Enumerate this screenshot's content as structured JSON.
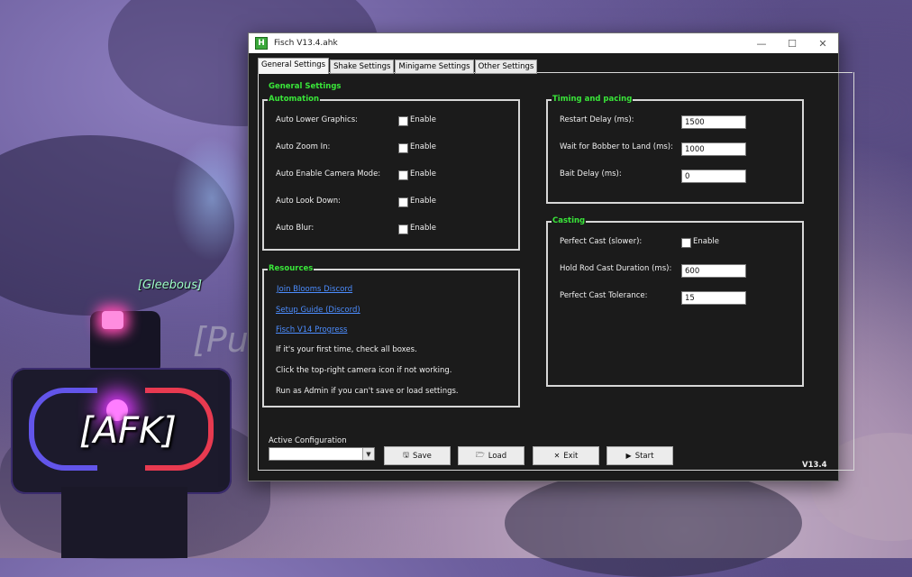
{
  "background": {
    "npc_name_1": "[Gleebous]",
    "npc_name_2": "[Pu",
    "player_tag": "[AFK]"
  },
  "window": {
    "title": "Fisch V13.4.ahk",
    "app_icon_letter": "H",
    "controls": {
      "minimize": "—",
      "maximize": "☐",
      "close": "✕"
    }
  },
  "tabs": [
    "General Settings",
    "Shake Settings",
    "Minigame Settings",
    "Other Settings"
  ],
  "active_tab": "General Settings",
  "section_title": "General Settings",
  "automation": {
    "label": "Automation",
    "checkbox_label": "Enable",
    "items": [
      {
        "label": "Auto Lower Graphics:",
        "checked": false
      },
      {
        "label": "Auto Zoom In:",
        "checked": false
      },
      {
        "label": "Auto Enable Camera Mode:",
        "checked": false
      },
      {
        "label": "Auto Look Down:",
        "checked": false
      },
      {
        "label": "Auto Blur:",
        "checked": false
      }
    ]
  },
  "resources": {
    "label": "Resources",
    "links": [
      "Join Blooms Discord",
      "Setup Guide (Discord)",
      "Fisch V14 Progress"
    ],
    "notes": [
      "If it's your first time, check all boxes.",
      "Click the top-right camera icon if not working.",
      "Run as Admin if you can't save or load settings."
    ]
  },
  "timing": {
    "label": "Timing and pacing",
    "fields": [
      {
        "label": "Restart Delay (ms):",
        "value": "1500"
      },
      {
        "label": "Wait for Bobber to Land (ms):",
        "value": "1000"
      },
      {
        "label": "Bait Delay (ms):",
        "value": "0"
      }
    ]
  },
  "casting": {
    "label": "Casting",
    "perfect_cast_label": "Perfect Cast (slower):",
    "perfect_cast_checkbox": "Enable",
    "perfect_cast_checked": false,
    "fields": [
      {
        "label": "Hold Rod Cast Duration (ms):",
        "value": "600"
      },
      {
        "label": "Perfect Cast Tolerance:",
        "value": "15"
      }
    ]
  },
  "footer": {
    "active_config_label": "Active Configuration",
    "active_config_value": "",
    "buttons": {
      "save": {
        "icon": "save-icon",
        "label": "Save"
      },
      "load": {
        "icon": "folder-icon",
        "label": "Load"
      },
      "exit": {
        "icon": "close-icon",
        "label": "Exit"
      },
      "start": {
        "icon": "play-icon",
        "label": "Start"
      }
    },
    "version": "V13.4"
  },
  "colors": {
    "accent_green": "#39e639",
    "link_blue": "#4c8dff",
    "window_bg": "#1b1b1b"
  }
}
